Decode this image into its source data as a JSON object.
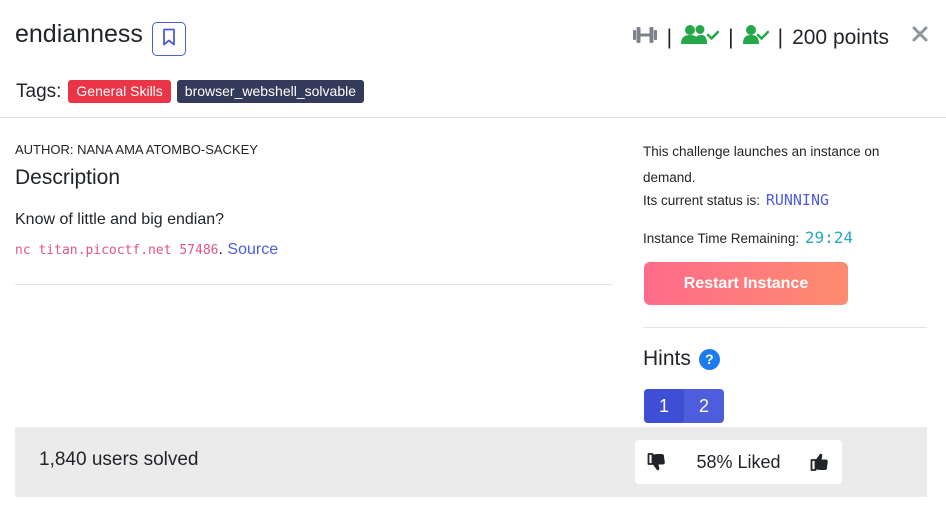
{
  "challenge": {
    "title": "endianness",
    "points": "200 points",
    "separator": "|"
  },
  "tags": {
    "label": "Tags:",
    "items": [
      {
        "text": "General Skills",
        "color": "#e93546"
      },
      {
        "text": "browser_webshell_solvable",
        "color": "#343a59"
      }
    ]
  },
  "author": "AUTHOR: NANA AMA ATOMBO-SACKEY",
  "description": {
    "heading": "Description",
    "text": "Know of little and big endian?",
    "command": "nc titan.picoctf.net 57486",
    "punctuation": ".",
    "source_label": "Source"
  },
  "instance": {
    "launch_text": "This challenge launches an instance on demand.",
    "status_label": "Its current status is:",
    "status_value": "RUNNING",
    "timer_label": "Instance Time Remaining:",
    "timer_value": "29:24",
    "restart_label": "Restart Instance"
  },
  "hints": {
    "title": "Hints",
    "help_glyph": "?",
    "buttons": [
      "1",
      "2"
    ]
  },
  "footer": {
    "solved_text": "1,840 users solved",
    "liked_text": "58% Liked"
  },
  "icons": {
    "difficulty": "dumbbell-icon",
    "team_solved": "users-check-icon",
    "user_solved": "user-check-icon",
    "bookmark": "bookmark-icon",
    "close": "close-icon",
    "dislike": "thumbs-down-icon",
    "like": "thumbs-up-icon"
  },
  "colors": {
    "accent": "#4e5ddb",
    "solved_green": "#26a849",
    "command_pink": "#e05685",
    "timer_cyan": "#27a7c7"
  }
}
